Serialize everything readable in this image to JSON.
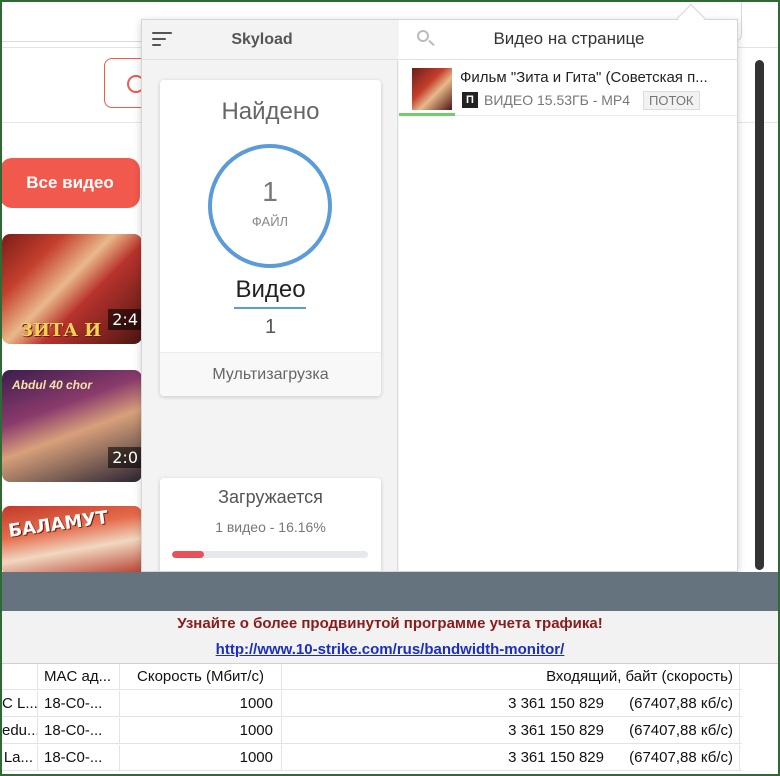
{
  "background_page": {
    "all_videos_button": "Все видео",
    "thumbs": [
      {
        "title": "ЗИТА И ГИТА",
        "duration": "2:4"
      },
      {
        "poster": "Abdul 40 chor",
        "duration": "2:0"
      },
      {
        "title": "БАЛАМУТ"
      }
    ]
  },
  "skyload": {
    "app_title": "Skyload",
    "found_card": {
      "title": "Найдено",
      "count": "1",
      "count_label": "ФАЙЛ",
      "type_label": "Видео",
      "type_count": "1",
      "multi_download": "Мультизагрузка"
    },
    "loading_card": {
      "title": "Загружается",
      "subtitle": "1 видео - 16.16%",
      "progress_percent": 16.16
    },
    "right_header": {
      "title": "Видео на странице"
    },
    "video_item": {
      "name": "Фильм \"Зита и Гита\" (Советская п...",
      "badge": "П",
      "meta": "ВИДЕО 15.53ГБ - MP4",
      "tag": "ПОТОК"
    }
  },
  "monitor": {
    "promo_text": "Узнайте о более продвинутой программе учета трафика!",
    "promo_link": "http://www.10-strike.com/rus/bandwidth-monitor/",
    "columns": [
      "",
      "MAC ад...",
      "Скорость (Мбит/с)",
      "Входящий, байт (скорость)"
    ],
    "rows": [
      {
        "name": "C L...",
        "mac": "18-C0-...",
        "speed": "1000",
        "incoming": "3 361 150 829",
        "rate": "(67407,88 кб/с)"
      },
      {
        "name": "edu...",
        "mac": "18-C0-...",
        "speed": "1000",
        "incoming": "3 361 150 829",
        "rate": "(67407,88 кб/с)"
      },
      {
        "name": "La...",
        "mac": "18-C0-...",
        "speed": "1000",
        "incoming": "3 361 150 829",
        "rate": "(67407,88 кб/с)"
      }
    ]
  },
  "colors": {
    "accent_red": "#f2594d",
    "ring_blue": "#5b9bd9",
    "progress_red": "#e8515a",
    "promo_red": "#8b1a1a",
    "link_blue": "#1a2fbf",
    "frame_green": "#2e6b34"
  }
}
